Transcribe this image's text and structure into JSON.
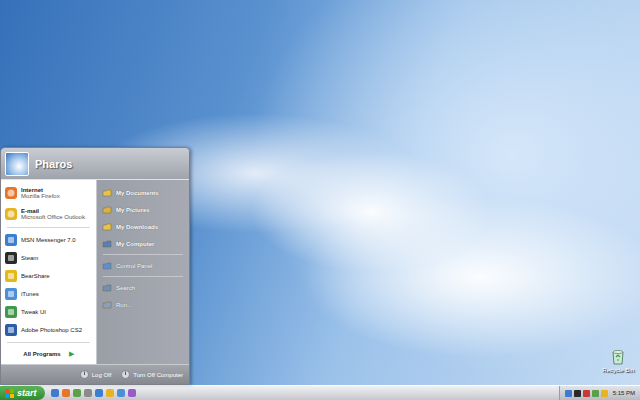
{
  "start_menu": {
    "user": "Pharos",
    "pinned": [
      {
        "title": "Internet",
        "subtitle": "Mozilla Firefox"
      },
      {
        "title": "E-mail",
        "subtitle": "Microsoft Office Outlook"
      }
    ],
    "recent": [
      "MSN Messenger 7.0",
      "Steam",
      "BearShare",
      "iTunes",
      "Tweak UI",
      "Adobe Photoshop CS2"
    ],
    "all_programs": {
      "label": "All Programs",
      "arrow": "▶"
    },
    "place_groups": [
      {
        "bold": true,
        "items": [
          "My Documents",
          "My Pictures",
          "My Downloads",
          "My Computer"
        ]
      },
      {
        "bold": false,
        "items": [
          "Control Panel"
        ]
      },
      {
        "bold": false,
        "items": [
          "Search",
          "Run..."
        ]
      }
    ],
    "footer": [
      "Log Off",
      "Turn Off Computer"
    ]
  },
  "taskbar": {
    "start": "start",
    "clock": "5:15 PM"
  },
  "desktop_icons": [
    {
      "label": "Recycle Bin"
    }
  ]
}
